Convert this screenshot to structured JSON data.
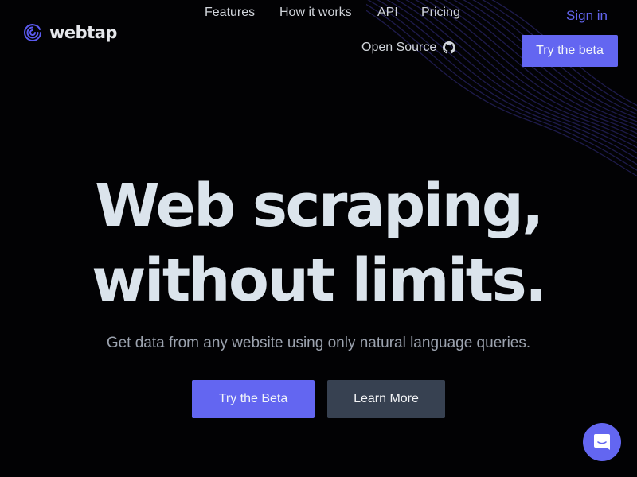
{
  "brand": {
    "name": "webtap",
    "accent": "#6366f1"
  },
  "nav": {
    "items": [
      {
        "label": "Features"
      },
      {
        "label": "How it works"
      },
      {
        "label": "API"
      },
      {
        "label": "Pricing"
      }
    ],
    "open_source": {
      "label": "Open Source",
      "icon": "github-icon"
    },
    "sign_in": "Sign in",
    "try_beta": "Try the beta"
  },
  "hero": {
    "title_line1": "Web scraping,",
    "title_line2": "without limits.",
    "subtitle": "Get data from any website using only natural language queries.",
    "primary_cta": "Try the Beta",
    "secondary_cta": "Learn More"
  },
  "chat_widget": {
    "icon": "chat-bubble-icon"
  }
}
